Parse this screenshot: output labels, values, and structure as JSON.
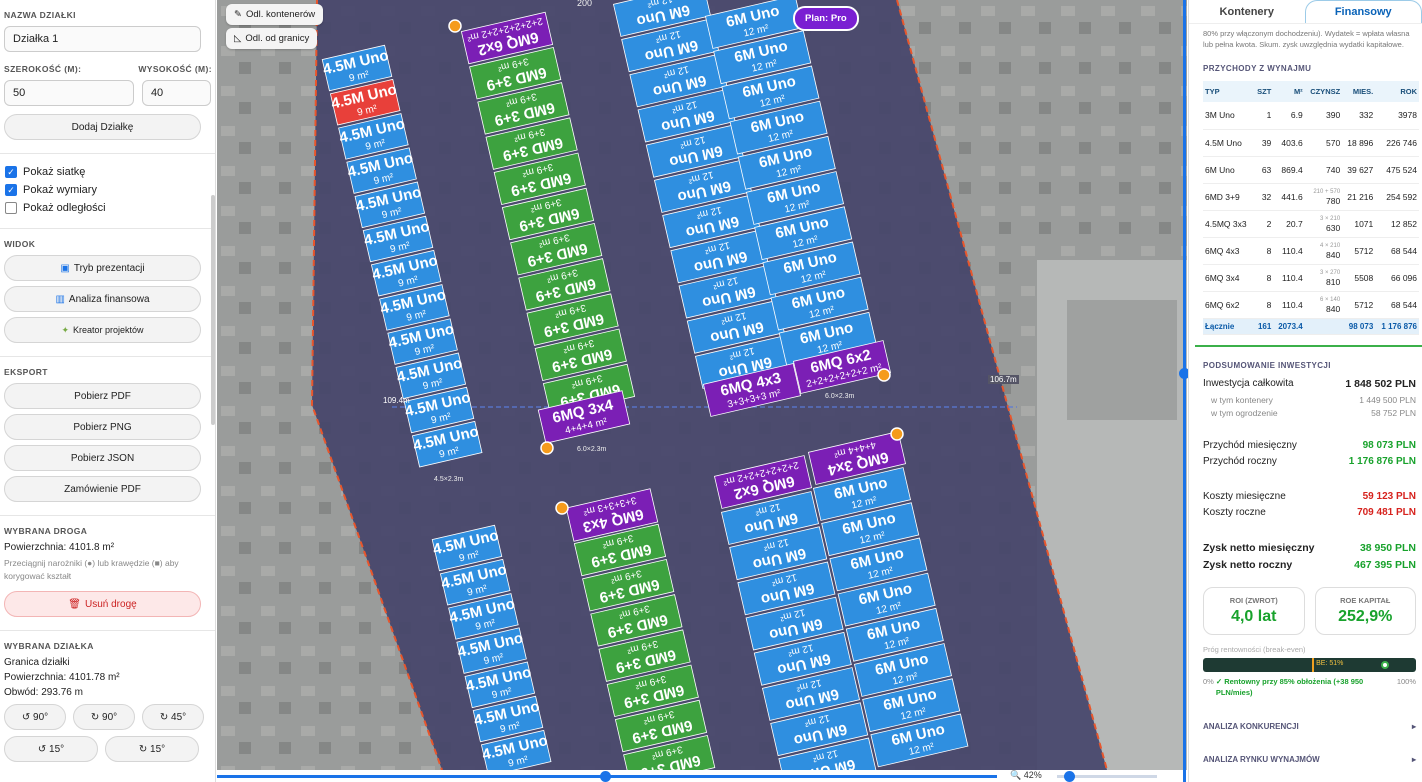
{
  "left": {
    "plot_name_label": "NAZWA DZIAŁKI",
    "plot_name_value": "Działka 1",
    "width_label": "SZEROKOŚĆ (M):",
    "width_value": "50",
    "height_label": "WYSOKOŚĆ (M):",
    "height_value": "40",
    "add_plot": "Dodaj Działkę",
    "show_grid": "Pokaż siatkę",
    "show_dims": "Pokaż wymiary",
    "show_dist": "Pokaż odległości",
    "view_label": "WIDOK",
    "presentation": "Tryb prezentacji",
    "financial": "Analiza finansowa",
    "wizard": "Kreator projektów",
    "export_label": "EKSPORT",
    "pdf": "Pobierz PDF",
    "png": "Pobierz PNG",
    "json": "Pobierz JSON",
    "order_pdf": "Zamówienie PDF",
    "road_label": "WYBRANA DROGA",
    "road_area": "Powierzchnia: 4101.8 m²",
    "road_hint": "Przeciągnij narożniki (●) lub krawędzie (■) aby korygować kształt",
    "delete_road": "Usuń drogę",
    "plot_label": "WYBRANA DZIAŁKA",
    "plot_border": "Granica działki",
    "plot_area": "Powierzchnia: 4101.78 m²",
    "plot_perimeter": "Obwód: 293.76 m",
    "rot_ccw90": "↺ 90°",
    "rot_cw90": "↻ 90°",
    "rot_cw45": "↻ 45°",
    "rot_ccw15": "↺ 15°",
    "rot_cw15": "↻ 15°"
  },
  "map": {
    "dist_containers": "Odl. kontenerów",
    "dist_border": "Odl. od granicy",
    "plan": "Plan: Pro",
    "zoom": "42%",
    "dim1": "109.4m",
    "dim2": "106.7m",
    "col1_label": "4.5×2.3m",
    "col2_label": "6.0×2.3m",
    "col3_label": "6.0×2.3m",
    "top_label": "200",
    "unit_4_5": "4.5M Uno",
    "area_4_5": "9 m²",
    "unit_6": "6M Uno",
    "area_6": "12 m²",
    "unit_6md": "6MD 3+9",
    "area_6md": "3+9 m²",
    "unit_4x3": "6MQ 4x3",
    "area_4x3": "4+4+4 m²",
    "area_4x3b": "3+3+3+3 m²",
    "unit_3x4": "6MQ 3x4",
    "unit_6x2": "6MQ 6x2",
    "area_6x2": "2+2+2+2+2+2 m²",
    "colors": {
      "blue": "#2f8fe0",
      "green": "#3da23f",
      "purple": "#7b1fb5",
      "red": "#e8403a"
    }
  },
  "right": {
    "tab_containers": "Kontenery",
    "tab_finance": "Finansowy",
    "note": "80% przy włączonym dochodzeniu). Wydatek = wpłata własna lub pełna kwota. Skum. zysk uwzględnia wydatki kapitałowe.",
    "rent_label": "PRZYCHODY Z WYNAJMU",
    "headers": [
      "TYP",
      "SZT",
      "M²",
      "CZYNSZ",
      "MIES.",
      "ROK"
    ],
    "rows": [
      [
        "3M Uno",
        "1",
        "6.9",
        "390",
        "332",
        "3978"
      ],
      [
        "4.5M Uno",
        "39",
        "403.6",
        "570",
        "18 896",
        "226 746"
      ],
      [
        "6M Uno",
        "63",
        "869.4",
        "740",
        "39 627",
        "475 524"
      ],
      [
        "6MD 3+9",
        "32",
        "441.6",
        "210 + 570 780",
        "21 216",
        "254 592"
      ],
      [
        "4.5MQ 3x3",
        "2",
        "20.7",
        "3 × 210 630",
        "1071",
        "12 852"
      ],
      [
        "6MQ 4x3",
        "8",
        "110.4",
        "4 × 210 840",
        "5712",
        "68 544"
      ],
      [
        "6MQ 3x4",
        "8",
        "110.4",
        "3 × 270 810",
        "5508",
        "66 096"
      ],
      [
        "6MQ 6x2",
        "8",
        "110.4",
        "6 × 140 840",
        "5712",
        "68 544"
      ]
    ],
    "total": [
      "Łącznie",
      "161",
      "2073.4",
      "",
      "98 073",
      "1 176 876"
    ],
    "summary_label": "PODSUMOWANIE INWESTYCJI",
    "inv_total_l": "Inwestycja całkowita",
    "inv_total_v": "1 848 502 PLN",
    "inv_cont_l": "w tym kontenery",
    "inv_cont_v": "1 449 500 PLN",
    "inv_fence_l": "w tym ogrodzenie",
    "inv_fence_v": "58 752 PLN",
    "inc_m_l": "Przychód miesięczny",
    "inc_m_v": "98 073 PLN",
    "inc_y_l": "Przychód roczny",
    "inc_y_v": "1 176 876 PLN",
    "cost_m_l": "Koszty miesięczne",
    "cost_m_v": "59 123 PLN",
    "cost_y_l": "Koszty roczne",
    "cost_y_v": "709 481 PLN",
    "net_m_l": "Zysk netto miesięczny",
    "net_m_v": "38 950 PLN",
    "net_y_l": "Zysk netto roczny",
    "net_y_v": "467 395 PLN",
    "roi_l": "ROI (ZWROT)",
    "roi_v": "4,0 lat",
    "roe_l": "ROE KAPITAŁ",
    "roe_v": "252,9%",
    "be_label": "Próg rentowności (break-even)",
    "be_marker": "BE: 51%",
    "be_fraction": 0.51,
    "be_current": 0.85,
    "be_min": "0%",
    "be_note": "✓ Rentowny przy 85% obłożenia (+38 950 PLN/mies)",
    "be_max": "100%",
    "competition": "ANALIZA KONKURENCJI",
    "market": "ANALIZA RYNKU WYNAJMÓW"
  }
}
